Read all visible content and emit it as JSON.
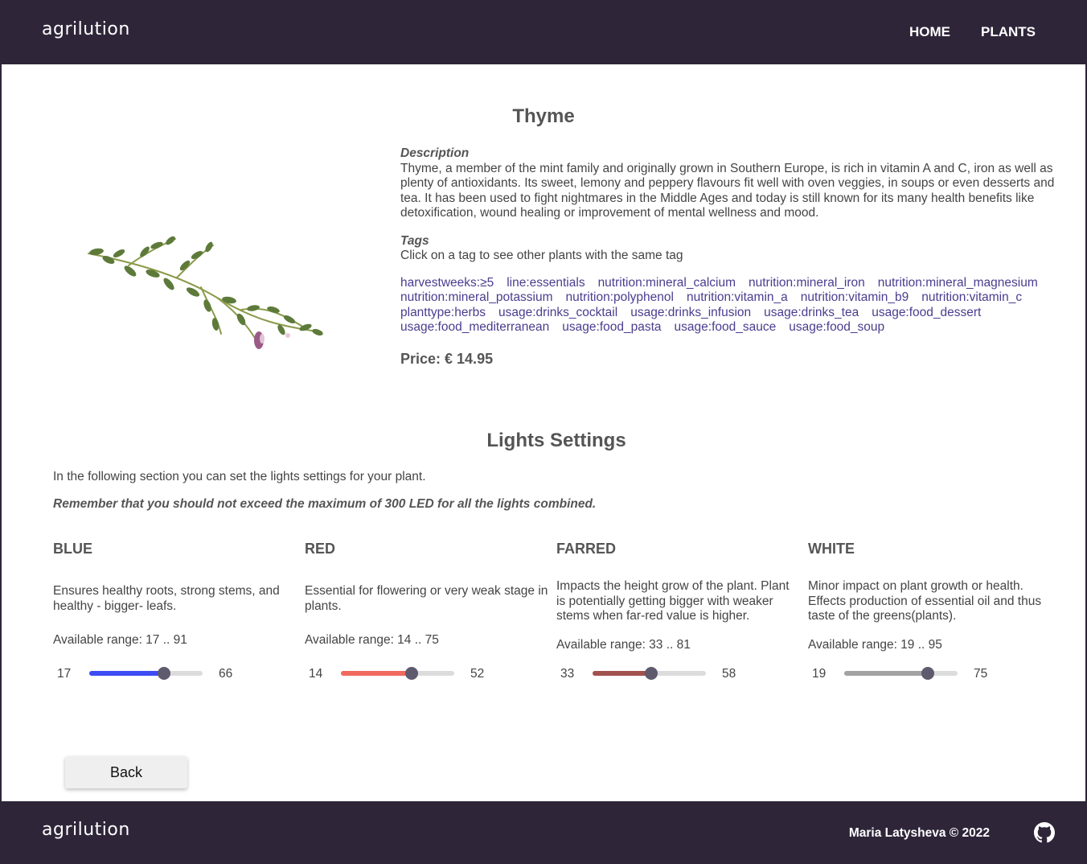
{
  "header": {
    "logo": "agrilution",
    "nav": [
      {
        "label": "HOME"
      },
      {
        "label": "PLANTS"
      }
    ]
  },
  "plant": {
    "name": "Thyme",
    "description_label": "Description",
    "description": "Thyme, a member of the mint family and originally grown in Southern Europe, is rich in vitamin A and C, iron as well as plenty of antioxidants. Its sweet, lemony and peppery flavours fit well with oven veggies, in soups or even desserts and tea. It has been used to fight nightmares in the Middle Ages and today is still known for its many health benefits like detoxification, wound healing or improvement of mental wellness and mood.",
    "tags_label": "Tags",
    "tags_help": "Click on a tag to see other plants with the same tag",
    "tags": [
      "harvestweeks:≥5",
      "line:essentials",
      "nutrition:mineral_calcium",
      "nutrition:mineral_iron",
      "nutrition:mineral_magnesium",
      "nutrition:mineral_potassium",
      "nutrition:polyphenol",
      "nutrition:vitamin_a",
      "nutrition:vitamin_b9",
      "nutrition:vitamin_c",
      "planttype:herbs",
      "usage:drinks_cocktail",
      "usage:drinks_infusion",
      "usage:drinks_tea",
      "usage:food_dessert",
      "usage:food_mediterranean",
      "usage:food_pasta",
      "usage:food_sauce",
      "usage:food_soup"
    ],
    "price": "Price: € 14.95"
  },
  "lights": {
    "title": "Lights Settings",
    "intro": "In the following section you can set the lights settings for your plant.",
    "warning": "Remember that you should not exceed the maximum of 300 LED for all the lights combined.",
    "items": [
      {
        "name": "BLUE",
        "description": "Ensures healthy roots, strong stems, and healthy - bigger- leafs.",
        "range_text": "Available range: 17 .. 91",
        "min": 17,
        "max": 91,
        "min_label": "17",
        "value_label": "66",
        "value": 66,
        "color": "#3d4cf5"
      },
      {
        "name": "RED",
        "description": "Essential for flowering or very weak stage in plants.",
        "range_text": "Available range: 14 .. 75",
        "min": 14,
        "max": 75,
        "min_label": "14",
        "value_label": "52",
        "value": 52,
        "color": "#f06a5e"
      },
      {
        "name": "FARRED",
        "description": "Impacts the height grow of the plant. Plant is potentially getting bigger with weaker stems when far-red value is higher.",
        "range_text": "Available range: 33 .. 81",
        "min": 33,
        "max": 81,
        "min_label": "33",
        "value_label": "58",
        "value": 58,
        "color": "#a3514f"
      },
      {
        "name": "WHITE",
        "description": "Minor impact on plant growth or health. Effects production of essential oil and thus taste of the greens(plants).",
        "range_text": "Available range: 19 .. 95",
        "min": 19,
        "max": 95,
        "min_label": "19",
        "value_label": "75",
        "value": 75,
        "color": "#a3a3a3"
      }
    ]
  },
  "back_button": "Back",
  "footer": {
    "logo": "agrilution",
    "copyright": "Maria Latysheva © 2022",
    "icon": "github-icon"
  }
}
